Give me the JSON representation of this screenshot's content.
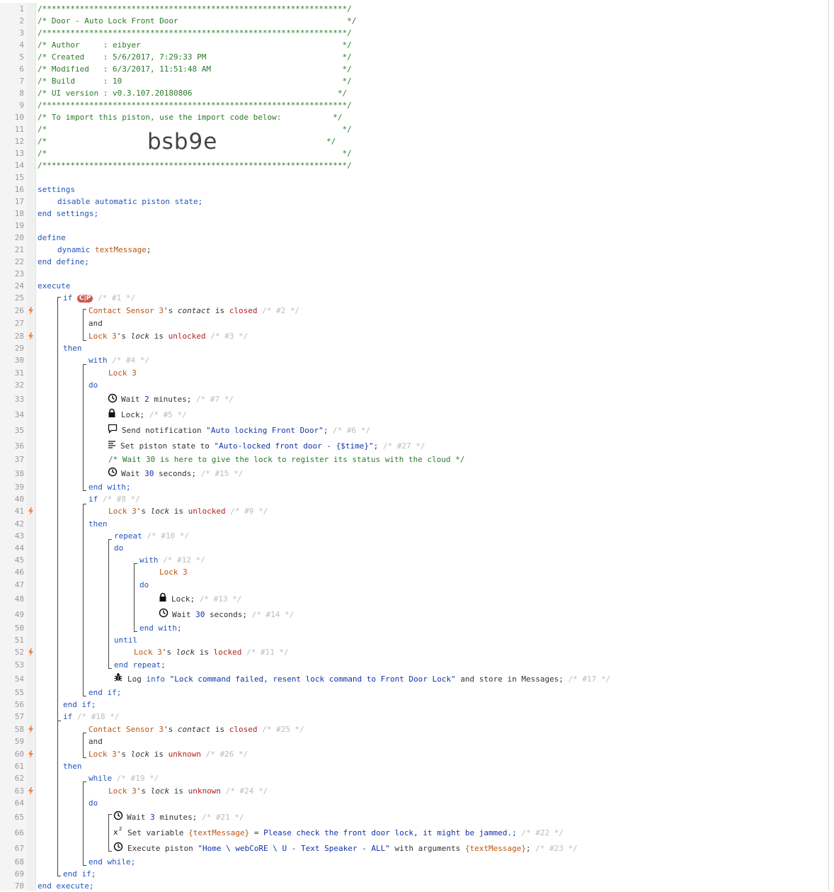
{
  "header": {
    "stars": "/*****************************************************************/",
    "title": "/* Door - Auto Lock Front Door                                    */",
    "author": "/* Author     : eibyer                                           */",
    "created": "/* Created    : 5/6/2017, 7:29:33 PM                             */",
    "modified": "/* Modified   : 6/3/2017, 11:51:48 AM                            */",
    "build": "/* Build      : 10                                               */",
    "ui_version": "/* UI version : v0.3.107.20180806                               */",
    "import_note": "/* To import this piston, use the import code below:           */",
    "blank": "/*                                                               */",
    "blank_short": "/*",
    "blank_end": "*/",
    "import_code": "bsb9e"
  },
  "line_numbers": [
    "1",
    "2",
    "3",
    "4",
    "5",
    "6",
    "7",
    "8",
    "9",
    "10",
    "11",
    "12",
    "13",
    "14",
    "15",
    "16",
    "17",
    "18",
    "19",
    "20",
    "21",
    "22",
    "23",
    "24",
    "25",
    "26",
    "27",
    "28",
    "29",
    "30",
    "31",
    "32",
    "33",
    "34",
    "35",
    "36",
    "37",
    "38",
    "39",
    "40",
    "41",
    "42",
    "43",
    "44",
    "45",
    "46",
    "47",
    "48",
    "49",
    "50",
    "51",
    "52",
    "53",
    "54",
    "55",
    "56",
    "57",
    "58",
    "59",
    "60",
    "61",
    "62",
    "63",
    "64",
    "65",
    "66",
    "67",
    "68",
    "69",
    "70"
  ],
  "code": {
    "settings": "settings",
    "disable": "disable automatic piston state;",
    "end_settings": "end settings;",
    "define": "define",
    "dynamic": "dynamic",
    "text_message": "textMessage",
    "semicolon": ";",
    "end_define": "end define;",
    "execute": "execute",
    "if": "if",
    "cp": "C|P",
    "c1": "/* #1 */",
    "contact_sensor": "Contact Sensor 3",
    "poss": "'s",
    "contact": "contact",
    "is": "is",
    "closed": "closed",
    "c2": "/* #2 */",
    "and": "and",
    "lock3": "Lock 3",
    "lock_attr": "lock",
    "unlocked": "unlocked",
    "c3": "/* #3 */",
    "then": "then",
    "with": "with",
    "c4": "/* #4 */",
    "do": "do",
    "wait": "Wait",
    "two": "2",
    "minutes": "minutes;",
    "c7": "/* #7 */",
    "lock_cmd": "Lock;",
    "c5": "/* #5 */",
    "send_notification": "Send notification",
    "notif_text": "\"Auto locking Front Door\"",
    "c6": "/* #6 */",
    "set_state": "Set piston state to",
    "state_text": "\"Auto-locked front door - {$time}\"",
    "c27": "/* #27 */",
    "wait_comment": "/* Wait 30 is here to give the lock to register its status with the cloud */",
    "thirty": "30",
    "seconds": "seconds;",
    "c15": "/* #15 */",
    "end_with": "end with;",
    "c8": "/* #8 */",
    "c9": "/* #9 */",
    "repeat": "repeat",
    "c10": "/* #10 */",
    "c12": "/* #12 */",
    "c13": "/* #13 */",
    "c14": "/* #14 */",
    "until": "until",
    "locked": "locked",
    "c11": "/* #11 */",
    "end_repeat": "end repeat;",
    "log": "Log",
    "info": "info",
    "log_text": "\"Lock command failed, resent lock command to Front Door Lock\"",
    "store": "and store in Messages;",
    "c17": "/* #17 */",
    "end_if": "end if;",
    "c18": "/* #18 */",
    "c25": "/* #25 */",
    "unknown": "unknown",
    "c26": "/* #26 */",
    "while": "while",
    "c19": "/* #19 */",
    "c24": "/* #24 */",
    "three": "3",
    "c21": "/* #21 */",
    "set_variable": "Set variable",
    "text_message_var": "{textMessage}",
    "equals": "=",
    "var_text": "Please check the front door lock, it might be jammed.;",
    "c22": "/* #22 */",
    "execute_piston": "Execute piston",
    "piston_name": "\"Home \\ webCoRE \\ U - Text Speaker - ALL\"",
    "with_args": "with arguments",
    "args_tail": ";",
    "c23": "/* #23 */",
    "end_while": "end while;",
    "end_execute": "end execute;"
  },
  "colors": {
    "comment_green": "#2c7a2c",
    "keyword_blue": "#2255bb",
    "device_orange": "#bb5511",
    "value_red": "#b22222",
    "condition_flag": "#f08040",
    "cp_badge": "#c85a4d"
  },
  "icons": {
    "flag": "lightning-flag-icon",
    "clock": "clock-icon",
    "lock": "padlock-icon",
    "notification": "speech-bubble-icon",
    "state": "text-lines-icon",
    "log": "bug-icon",
    "variable": "superscript-x2-icon"
  }
}
